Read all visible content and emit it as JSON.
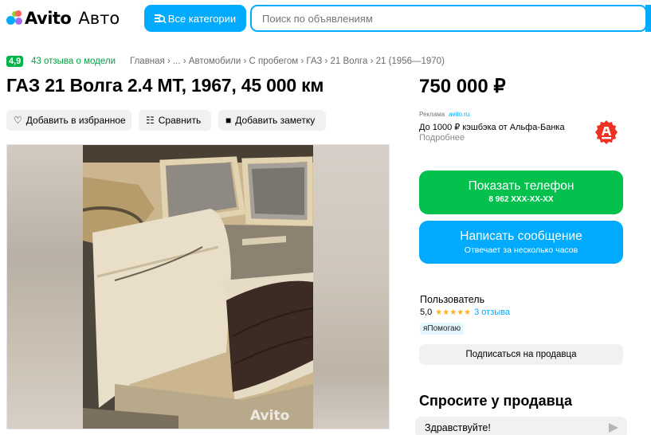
{
  "header": {
    "logo_primary": "Avito",
    "logo_secondary": "Авто",
    "categories_button": "Все категории",
    "search_placeholder": "Поиск по объявлениям"
  },
  "breadcrumbs": {
    "rating": "4,9",
    "reviews": "43 отзыва о модели",
    "path": "Главная › ... › Автомобили › С пробегом › ГАЗ › 21 Волга › 21 (1956—1970)"
  },
  "listing": {
    "title": "ГАЗ 21 Волга 2.4 MT, 1967, 45 000 км",
    "price": "750 000 ₽",
    "actions": {
      "favorite": "Добавить в избранное",
      "compare": "Сравнить",
      "note": "Добавить заметку"
    },
    "photo_watermark": "Avito"
  },
  "ad": {
    "label": "Реклама",
    "source": "avito.ru",
    "text": "До 1000 ₽ кэшбэка от Альфа-Банка",
    "more": "Подробнее"
  },
  "contact": {
    "phone_label": "Показать телефон",
    "phone_number": "8 962 XXX-XX-XX",
    "message_label": "Написать сообщение",
    "message_sub": "Отвечает за несколько часов"
  },
  "seller": {
    "name": "Пользователь",
    "rating": "5,0",
    "stars": 5,
    "stars_glyphs": "★★★★★",
    "reviews": "3 отзыва",
    "badge": "яПомогаю",
    "subscribe": "Подписаться на продавца"
  },
  "ask": {
    "title": "Спросите у продавца",
    "suggestion": "Здравствуйте!"
  },
  "colors": {
    "accent_blue": "#00aaff",
    "accent_green": "#04c14e",
    "star": "#ffb021",
    "alfa_red": "#ef3124"
  }
}
